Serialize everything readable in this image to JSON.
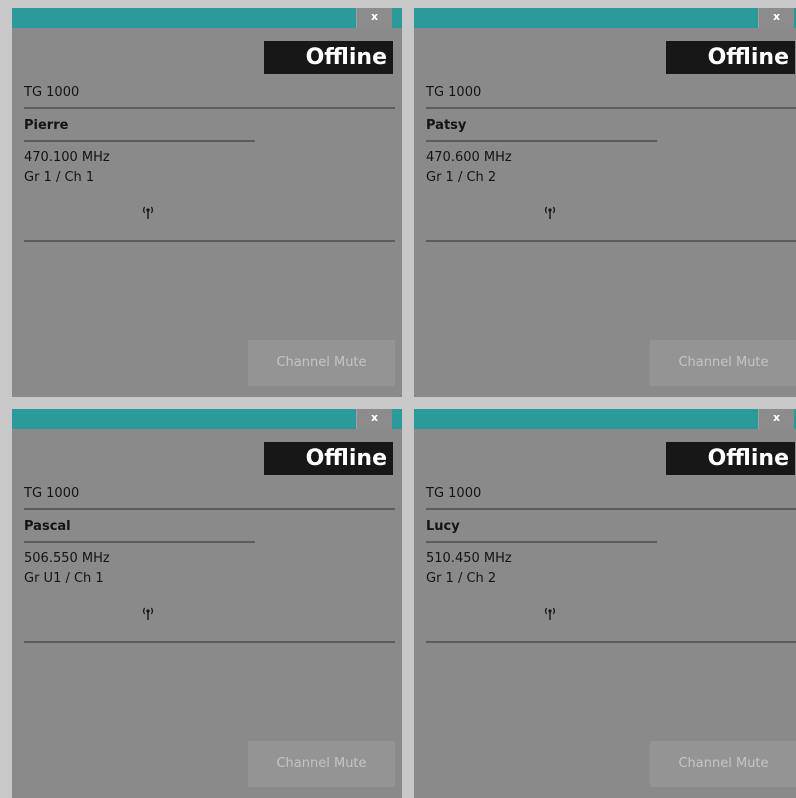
{
  "close_label": "x",
  "mute_label": "Channel Mute",
  "colors": {
    "titlebar": "#2c9a9a",
    "panel_bg": "#8a8a8a",
    "status_bg": "#171717",
    "background": "#c8c8c8"
  },
  "panels": [
    {
      "status": "Offline",
      "model": "TG 1000",
      "name": "Pierre",
      "frequency": "470.100 MHz",
      "group_channel": "Gr 1 / Ch 1",
      "icon": "antenna-icon"
    },
    {
      "status": "Offline",
      "model": "TG 1000",
      "name": "Patsy",
      "frequency": "470.600 MHz",
      "group_channel": "Gr 1 / Ch 2",
      "icon": "antenna-icon"
    },
    {
      "status": "Offline",
      "model": "TG 1000",
      "name": "Pascal",
      "frequency": "506.550 MHz",
      "group_channel": "Gr U1 / Ch 1",
      "icon": "antenna-icon"
    },
    {
      "status": "Offline",
      "model": "TG 1000",
      "name": "Lucy",
      "frequency": "510.450 MHz",
      "group_channel": "Gr 1 / Ch 2",
      "icon": "antenna-icon"
    }
  ]
}
